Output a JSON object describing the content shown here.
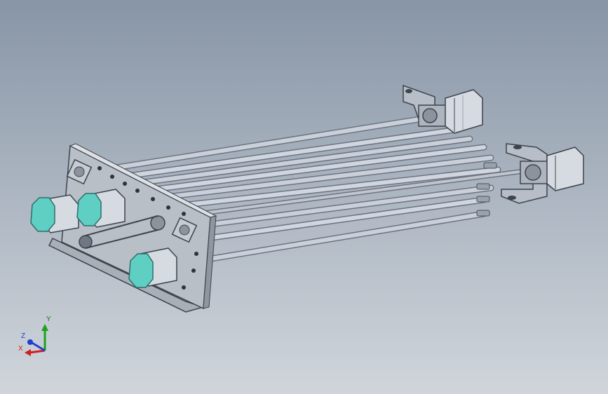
{
  "triad": {
    "x_label": "X",
    "y_label": "Y",
    "z_label": "Z",
    "x_color": "#d11f1f",
    "y_color": "#1aa31a",
    "z_color": "#1f3fd1"
  },
  "colors": {
    "background_top": "#8795a6",
    "background_bottom": "#d0d5db",
    "plate": "#b9bfc7",
    "rod": "#c9d0da",
    "motor_body": "#d6dbe2",
    "motor_cap": "#5fcfc4"
  }
}
